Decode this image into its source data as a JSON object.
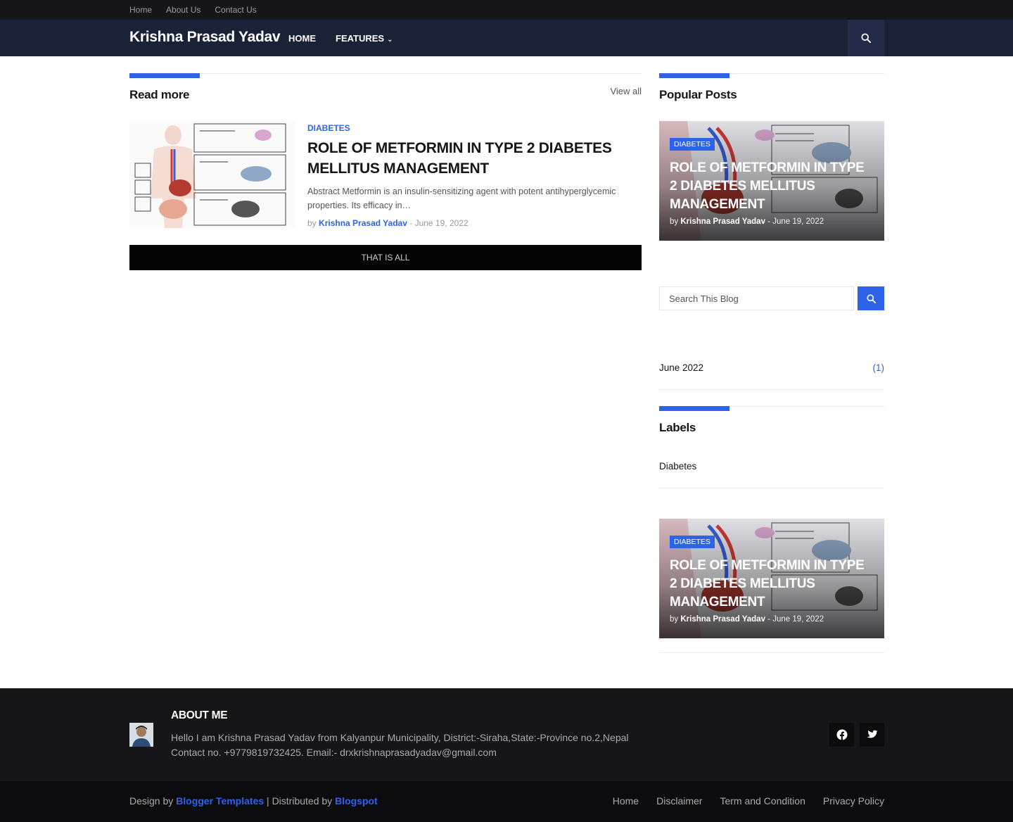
{
  "topbar": {
    "links": [
      "Home",
      "About Us",
      "Contact Us"
    ]
  },
  "header": {
    "brand": "Krishna Prasad Yadav",
    "nav": [
      "Home",
      "Features"
    ],
    "search_icon": "search-icon"
  },
  "main": {
    "section_title": "Read more",
    "view_all": "View all",
    "post": {
      "label": "Diabetes",
      "title": "Role of Metformin in Type 2 Diabetes Mellitus management",
      "snippet": "Abstract Metformin is an insulin-sensitizing agent with potent antihyperglycemic properties. Its efficacy in…",
      "by": "by",
      "author": "Krishna Prasad Yadav",
      "sep": "-",
      "date": "June 19, 2022"
    },
    "that_all": "That is All"
  },
  "sidebar": {
    "popular_title": "Popular Posts",
    "feature": {
      "tag": "Diabetes",
      "title": "Role of Metformin in Type 2 Diabetes Mellitus management",
      "by": "by",
      "author": "Krishna Prasad Yadav",
      "sep": "-",
      "date": "June 19, 2022"
    },
    "search": {
      "placeholder": "Search This Blog"
    },
    "archive": {
      "month": "June 2022",
      "count": "(1)"
    },
    "labels_title": "Labels",
    "labels": [
      "Diabetes"
    ],
    "feature2": {
      "tag": "Diabetes",
      "title": "Role of Metformin in Type 2 Diabetes Mellitus management",
      "by": "by",
      "author": "Krishna Prasad Yadav",
      "sep": "-",
      "date": "June 19, 2022"
    }
  },
  "footer": {
    "about_title": "About Me",
    "about_text": "Hello I am Krishna Prasad Yadav from Kalyanpur Municipality, District:-Siraha,State:-Province no.2,Nepal Contact no. +9779819732425. Email:- drxkrishnaprasadyadav@gmail.com",
    "social": [
      "facebook-icon",
      "twitter-icon"
    ]
  },
  "bottom": {
    "design_by": "Design by",
    "blogger_templates": "Blogger Templates",
    "distributed_by": "| Distributed by",
    "blogspot": "Blogspot",
    "menu": [
      "Home",
      "Disclaimer",
      "Term and Condition",
      "Privacy Policy"
    ]
  },
  "colors": {
    "accent": "#2e62e8",
    "header_bg": "#1a2238",
    "dark": "#161619"
  }
}
